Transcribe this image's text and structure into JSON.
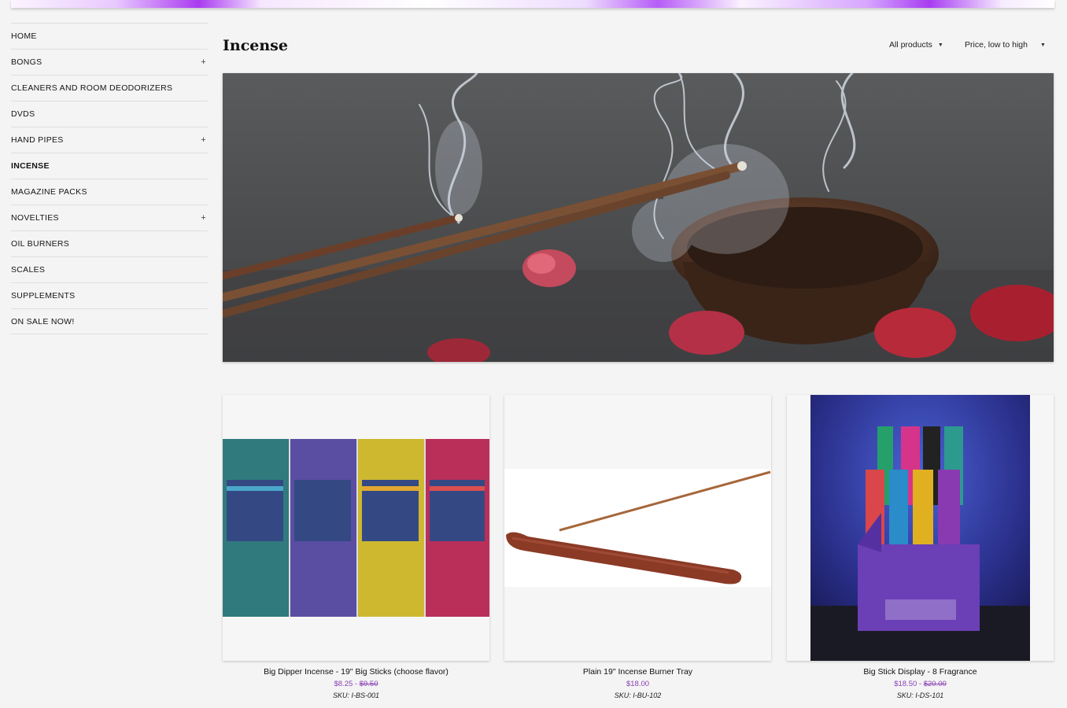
{
  "nav": {
    "items": [
      {
        "label": "HOME",
        "has_children": false,
        "active": false
      },
      {
        "label": "BONGS",
        "has_children": true,
        "active": false
      },
      {
        "label": "CLEANERS AND ROOM DEODORIZERS",
        "has_children": false,
        "active": false
      },
      {
        "label": "DVDs",
        "has_children": false,
        "active": false
      },
      {
        "label": "HAND PIPES",
        "has_children": true,
        "active": false
      },
      {
        "label": "INCENSE",
        "has_children": false,
        "active": true
      },
      {
        "label": "MAGAZINE PACKS",
        "has_children": false,
        "active": false
      },
      {
        "label": "NOVELTIES",
        "has_children": true,
        "active": false
      },
      {
        "label": "OIL BURNERS",
        "has_children": false,
        "active": false
      },
      {
        "label": "SCALES",
        "has_children": false,
        "active": false
      },
      {
        "label": "SUPPLEMENTS",
        "has_children": false,
        "active": false
      },
      {
        "label": "ON SALE NOW!",
        "has_children": false,
        "active": false
      }
    ],
    "expand_symbol": "+"
  },
  "page": {
    "title": "Incense",
    "filter_label": "All products",
    "sort_label": "Price, low to high"
  },
  "products": [
    {
      "name": "Big Dipper Incense - 19\" Big Sticks (choose flavor)",
      "price": "$8.25",
      "price_separator": "-",
      "compare_price": "$9.50",
      "sku": "SKU: I-BS-001"
    },
    {
      "name": "Plain 19\" Incense Burner Tray",
      "price": "$18.00",
      "price_separator": "",
      "compare_price": "",
      "sku": "SKU: I-BU-102"
    },
    {
      "name": "Big Stick Display - 8 Fragrance",
      "price": "$18.50",
      "price_separator": "-",
      "compare_price": "$20.00",
      "sku": "SKU: I-DS-101"
    }
  ],
  "colors": {
    "background": "#f4f4f4",
    "price_accent": "#8a3fb3",
    "banner_accent": "#a93bf0"
  }
}
